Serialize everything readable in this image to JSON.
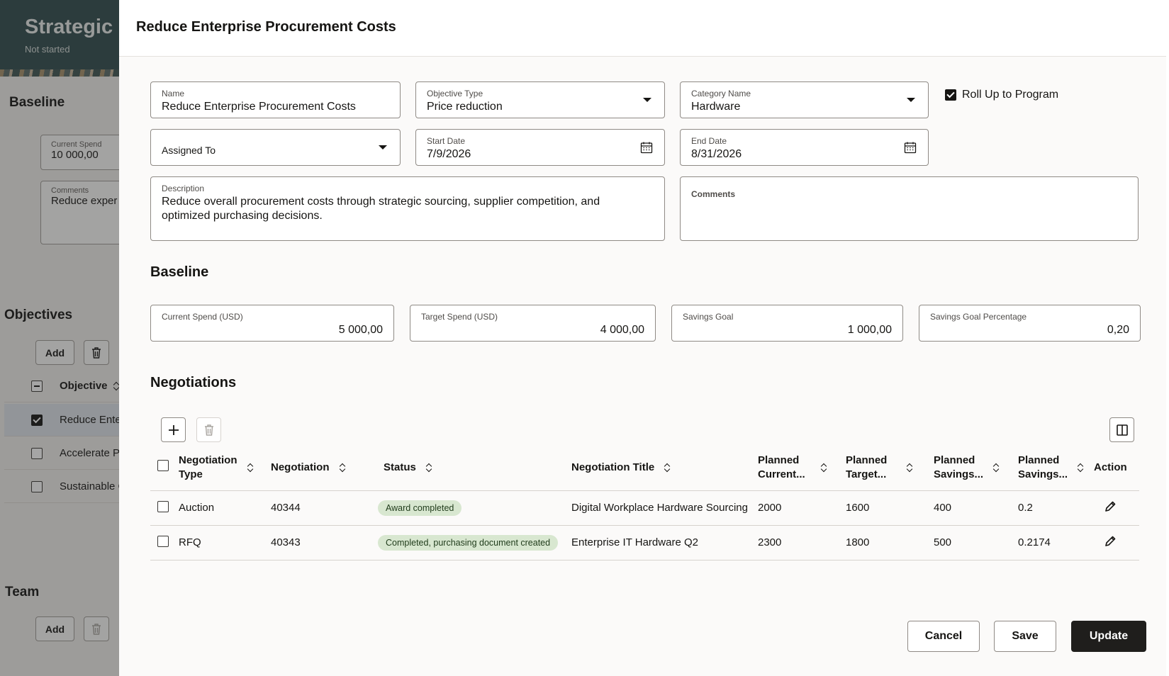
{
  "background": {
    "page_title": "Strategic S",
    "status": "Not started",
    "baseline_heading": "Baseline",
    "current_spend_label": "Current Spend",
    "current_spend_value": "10 000,00",
    "comments_label": "Comments",
    "comments_value": "Reduce exper",
    "objectives_heading": "Objectives",
    "add_label": "Add",
    "objective_column": "Objective",
    "objective_rows": [
      {
        "label": "Reduce Ente",
        "checked": true
      },
      {
        "label": "Accelerate Pr",
        "checked": false
      },
      {
        "label": "Sustainable C",
        "checked": false
      }
    ],
    "team_heading": "Team",
    "team_add_label": "Add"
  },
  "drawer": {
    "title": "Reduce Enterprise Procurement Costs",
    "form": {
      "name": {
        "label": "Name",
        "value": "Reduce Enterprise Procurement Costs"
      },
      "objective_type": {
        "label": "Objective Type",
        "value": "Price reduction"
      },
      "category_name": {
        "label": "Category Name",
        "value": "Hardware"
      },
      "roll_up": {
        "label": "Roll Up to Program",
        "checked": true
      },
      "assigned_to": {
        "label": "Assigned To",
        "value": ""
      },
      "start_date": {
        "label": "Start Date",
        "value": "7/9/2026"
      },
      "end_date": {
        "label": "End Date",
        "value": "8/31/2026"
      },
      "description": {
        "label": "Description",
        "value": "Reduce overall procurement costs through strategic sourcing, supplier competition, and optimized purchasing decisions."
      },
      "comments": {
        "label": "Comments",
        "value": ""
      }
    },
    "baseline": {
      "heading": "Baseline",
      "current_spend": {
        "label": "Current Spend (USD)",
        "value": "5 000,00"
      },
      "target_spend": {
        "label": "Target Spend (USD)",
        "value": "4 000,00"
      },
      "savings_goal": {
        "label": "Savings Goal",
        "value": "1 000,00"
      },
      "savings_goal_pct": {
        "label": "Savings Goal Percentage",
        "value": "0,20"
      }
    },
    "negotiations": {
      "heading": "Negotiations",
      "columns": {
        "type_line1": "Negotiation",
        "type_line2": "Type",
        "negotiation": "Negotiation",
        "status": "Status",
        "title": "Negotiation Title",
        "planned_current_line1": "Planned",
        "planned_current_line2": "Current...",
        "planned_target_line1": "Planned",
        "planned_target_line2": "Target...",
        "planned_savings_line1": "Planned",
        "planned_savings_line2": "Savings...",
        "planned_savings_pct_line1": "Planned",
        "planned_savings_pct_line2": "Savings...",
        "action": "Action"
      },
      "rows": [
        {
          "type": "Auction",
          "negotiation": "40344",
          "status": "Award completed",
          "title": "Digital Workplace Hardware Sourcing",
          "planned_current": "2000",
          "planned_target": "1600",
          "planned_savings": "400",
          "planned_savings_pct": "0.2"
        },
        {
          "type": "RFQ",
          "negotiation": "40343",
          "status": "Completed, purchasing document created",
          "title": "Enterprise IT Hardware Q2",
          "planned_current": "2300",
          "planned_target": "1800",
          "planned_savings": "500",
          "planned_savings_pct": "0.2174"
        }
      ]
    },
    "footer": {
      "cancel": "Cancel",
      "save": "Save",
      "update": "Update"
    }
  },
  "colors": {
    "badge_bg": "#d8e7d0",
    "primary_button": "#1f1e1c",
    "header_bg": "#2f4a4c"
  }
}
